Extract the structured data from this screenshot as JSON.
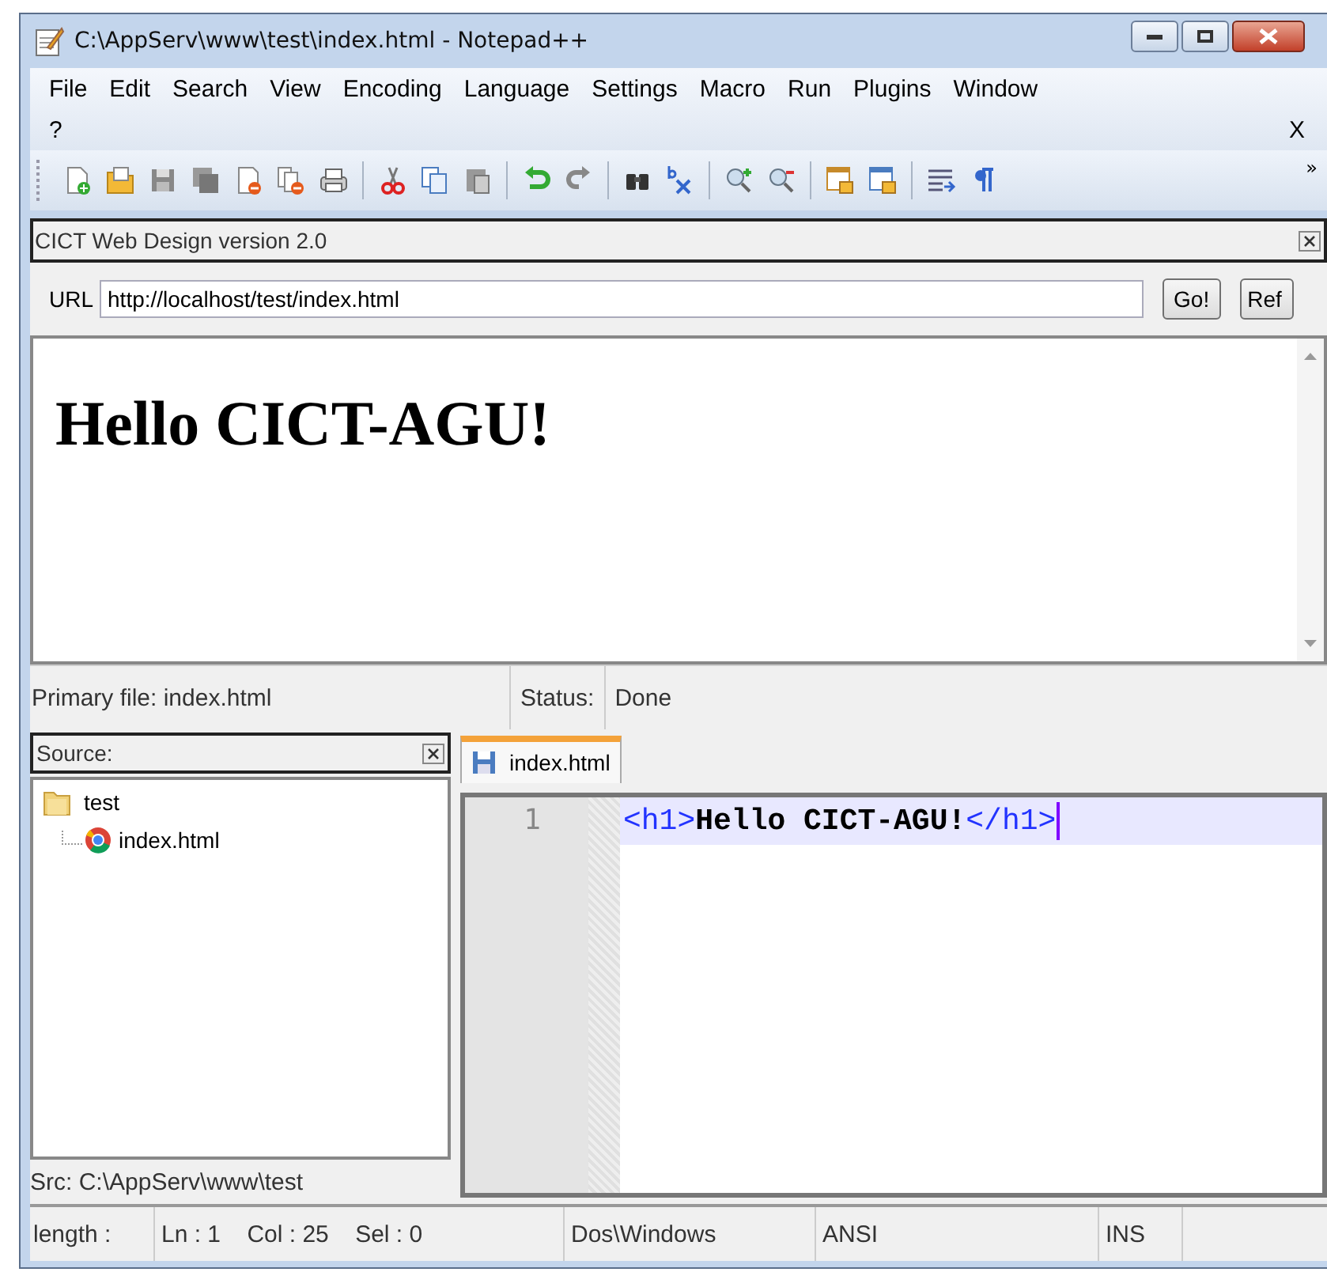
{
  "window": {
    "title": "C:\\AppServ\\www\\test\\index.html - Notepad++"
  },
  "menu": {
    "items": [
      "File",
      "Edit",
      "Search",
      "View",
      "Encoding",
      "Language",
      "Settings",
      "Macro",
      "Run",
      "Plugins",
      "Window",
      "?"
    ],
    "close_doc": "X"
  },
  "toolbar": {
    "overflow": "»"
  },
  "plugin_panel": {
    "title": "CICT Web Design version 2.0",
    "url_label": "URL",
    "url": "http://localhost/test/index.html",
    "buttons": [
      "Go!",
      "Ref"
    ],
    "preview_heading": "Hello CICT-AGU!",
    "status": {
      "primary": "Primary file: index.html",
      "status_label": "Status:",
      "status_value": "Done"
    }
  },
  "source_panel": {
    "title": "Source:",
    "tree": [
      {
        "label": "test",
        "kind": "folder",
        "children": [
          {
            "label": "index.html",
            "kind": "file"
          }
        ]
      }
    ],
    "footer": "Src: C:\\AppServ\\www\\test"
  },
  "tabs": [
    {
      "label": "index.html",
      "selected": true
    }
  ],
  "editor": {
    "lines": [
      {
        "number": "1",
        "current": true,
        "tokens": [
          {
            "text": "<h1>",
            "kind": "tag"
          },
          {
            "text": "Hello CICT-AGU!",
            "kind": "text"
          },
          {
            "text": "</h1>",
            "kind": "tag"
          }
        ]
      }
    ]
  },
  "status_bar": [
    "length :",
    "Ln : 1    Col : 25    Sel : 0",
    "Dos\\Windows",
    "ANSI",
    "INS"
  ]
}
